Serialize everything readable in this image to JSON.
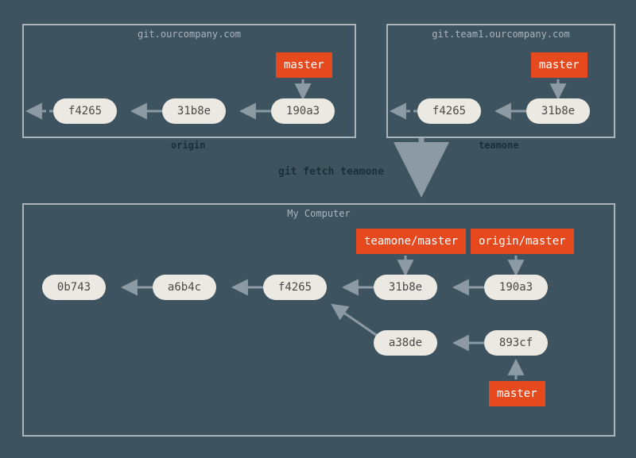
{
  "origin": {
    "url": "git.ourcompany.com",
    "label": "origin",
    "branch": "master",
    "commits": [
      "f4265",
      "31b8e",
      "190a3"
    ]
  },
  "teamone": {
    "url": "git.team1.ourcompany.com",
    "label": "teamone",
    "branch": "master",
    "commits": [
      "f4265",
      "31b8e"
    ]
  },
  "fetch_command": "git fetch teamone",
  "local": {
    "title": "My Computer",
    "remote_branches": [
      "teamone/master",
      "origin/master"
    ],
    "local_branch": "master",
    "row1": [
      "0b743",
      "a6b4c",
      "f4265",
      "31b8e",
      "190a3"
    ],
    "row2": [
      "a38de",
      "893cf"
    ]
  }
}
